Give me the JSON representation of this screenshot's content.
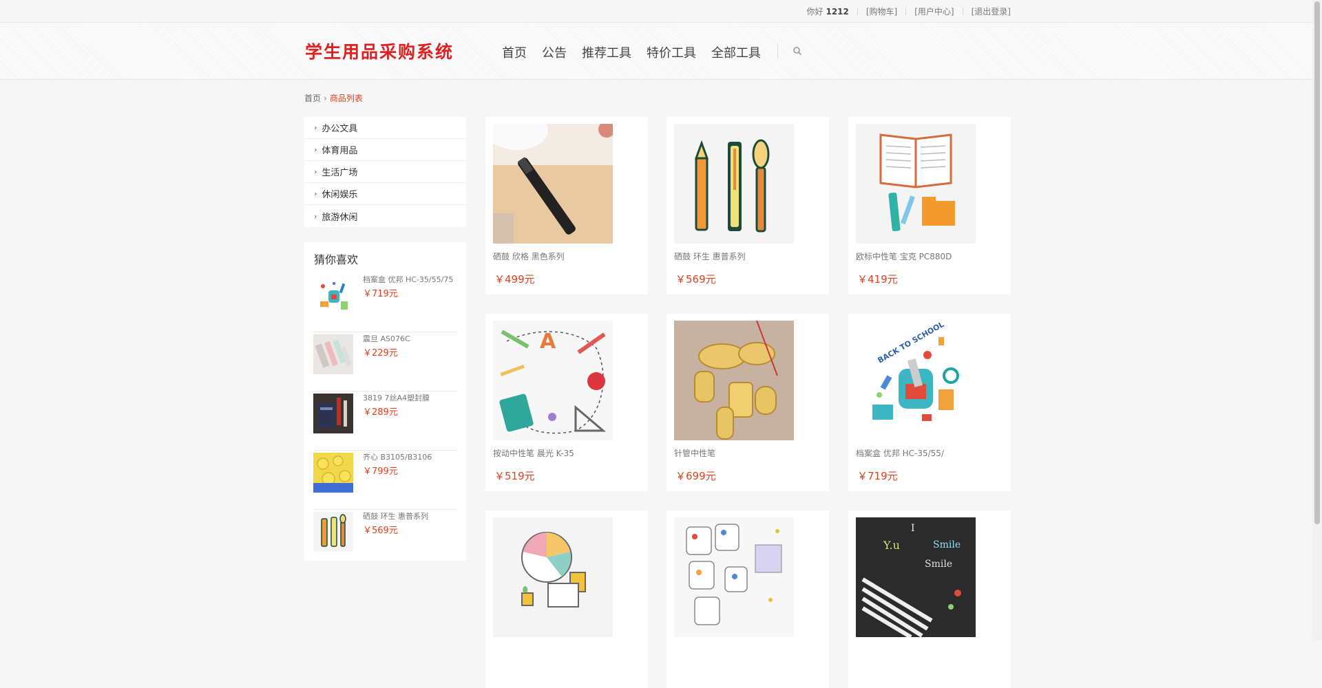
{
  "topbar": {
    "greeting": "你好",
    "username": "1212",
    "cart": "[购物车]",
    "user_center": "[用户中心]",
    "logout": "[退出登录]"
  },
  "header": {
    "logo": "学生用品采购系统",
    "nav": [
      "首页",
      "公告",
      "推荐工具",
      "特价工具",
      "全部工具"
    ]
  },
  "breadcrumb": {
    "home": "首页",
    "current": "商品列表"
  },
  "categories": [
    "办公文具",
    "体育用品",
    "生活广场",
    "休闲娱乐",
    "旅游休闲"
  ],
  "guess": {
    "title": "猜你喜欢",
    "items": [
      {
        "name": "档案盒 优邦 HC-35/55/75",
        "price": "￥719元"
      },
      {
        "name": "震旦 AS076C",
        "price": "￥229元"
      },
      {
        "name": "3819 7丝A4塑封膜",
        "price": "￥289元"
      },
      {
        "name": "齐心 B3105/B3106",
        "price": "￥799元"
      },
      {
        "name": "硒鼓 环生 惠普系列",
        "price": "￥569元"
      }
    ]
  },
  "products": [
    {
      "name": "硒鼓 欣格 黑色系列",
      "price": "￥499元"
    },
    {
      "name": "硒鼓 环生 惠普系列",
      "price": "￥569元"
    },
    {
      "name": "欧标中性笔 宝克 PC880D",
      "price": "￥419元"
    },
    {
      "name": "按动中性笔 晨光 K-35",
      "price": "￥519元"
    },
    {
      "name": "针管中性笔",
      "price": "￥699元"
    },
    {
      "name": "档案盒 优邦 HC-35/55/",
      "price": "￥719元"
    },
    {
      "name": "",
      "price": ""
    },
    {
      "name": "",
      "price": ""
    },
    {
      "name": "",
      "price": ""
    }
  ],
  "colors": {
    "accent": "#e0401c",
    "logo": "#e02020"
  }
}
